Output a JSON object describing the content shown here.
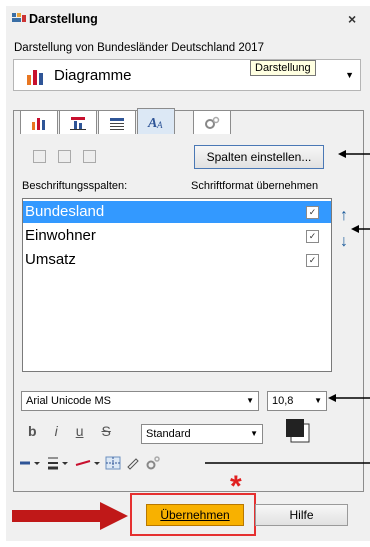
{
  "dialog": {
    "title": "Darstellung",
    "close": "×",
    "subtitle": "Darstellung von Bundesländer Deutschland 2017",
    "diagram_combo": "Diagramme",
    "tooltip": "Darstellung"
  },
  "tabs": [
    {
      "icon": "bar-chart-icon"
    },
    {
      "icon": "chart-format-icon"
    },
    {
      "icon": "table-icon"
    },
    {
      "icon": "font-icon"
    },
    {
      "icon": "gears-icon"
    }
  ],
  "columns_button": "Spalten einstellen...",
  "headers": {
    "left": "Beschriftungsspalten:",
    "right": "Schriftformat übernehmen"
  },
  "rows": [
    {
      "label": "Bundesland",
      "checked": true,
      "selected": true
    },
    {
      "label": "Einwohner",
      "checked": true,
      "selected": false
    },
    {
      "label": "Umsatz",
      "checked": true,
      "selected": false
    }
  ],
  "font": {
    "family": "Arial Unicode MS",
    "size": "10,8",
    "style": "Standard"
  },
  "format_buttons": {
    "bold": "b",
    "italic": "i",
    "underline": "u",
    "strike": "S"
  },
  "buttons": {
    "ok": "Übernehmen",
    "help": "Hilfe"
  },
  "annotation_star": "*",
  "colors": {
    "accent": "#f8b100",
    "highlight": "#e53030",
    "selection": "#3399ff"
  }
}
